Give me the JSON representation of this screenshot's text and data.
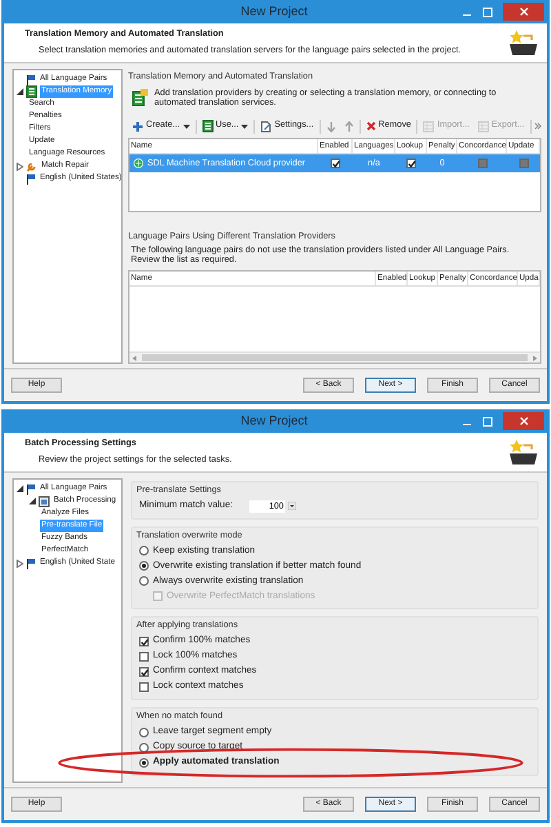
{
  "window_1": {
    "title": "New Project",
    "header": {
      "title": "Translation Memory and Automated Translation",
      "subtitle": "Select translation memories and automated translation servers for the language pairs selected in the project."
    },
    "tree": [
      {
        "label": "All Language Pairs",
        "selected": false
      },
      {
        "label": "Translation Memory",
        "expanded": true,
        "selected": true,
        "children": [
          {
            "label": "Search",
            "selected": false
          },
          {
            "label": "Penalties",
            "selected": false
          },
          {
            "label": "Filters",
            "selected": false
          },
          {
            "label": "Update",
            "selected": false
          },
          {
            "label": "Language Resources",
            "selected": false
          }
        ]
      },
      {
        "label": "Match Repair",
        "expanded": false,
        "selected": false
      },
      {
        "label": "English (United States)",
        "selected": false
      }
    ],
    "panel_title": "Translation Memory and Automated Translation",
    "info": "Add translation providers by creating or selecting a translation memory, or connecting to automated translation services.",
    "toolbar": [
      {
        "label": "Create...",
        "dropdown": true,
        "disabled": false
      },
      {
        "label": "Use...",
        "dropdown": true,
        "disabled": false
      },
      {
        "label": "Settings...",
        "dropdown": false,
        "disabled": false
      },
      {
        "dropdown": false,
        "disabled": true
      },
      {
        "dropdown": false,
        "disabled": true
      },
      {
        "label": "Remove",
        "dropdown": false,
        "disabled": false
      },
      {
        "label": "Import...",
        "dropdown": false,
        "disabled": true
      },
      {
        "label": "Export...",
        "dropdown": false,
        "disabled": true
      }
    ],
    "providers": {
      "columns": [
        "Name",
        "Enabled",
        "Languages",
        "Lookup",
        "Penalty",
        "Concordance",
        "Update"
      ],
      "rows": [
        {
          "selected": true,
          "cells": [
            {
              "kind": "name",
              "text": "SDL Machine Translation Cloud provider"
            },
            {
              "kind": "check",
              "checked": true,
              "disabled": false
            },
            {
              "kind": "text",
              "text": "n/a"
            },
            {
              "kind": "check",
              "checked": true,
              "disabled": false
            },
            {
              "kind": "text",
              "text": "0"
            },
            {
              "kind": "check",
              "checked": false,
              "disabled": true
            },
            {
              "kind": "check",
              "checked": false,
              "disabled": true
            }
          ]
        }
      ]
    },
    "other_title": "Language Pairs Using Different Translation Providers",
    "other_info": "The following language pairs do not use the translation providers listed under All Language Pairs. Review the list as required.",
    "other_table": {
      "columns": [
        "Name",
        "Enabled",
        "Lookup",
        "Penalty",
        "Concordance",
        "Upda"
      ]
    },
    "footer": {
      "left": [
        {
          "label": "Help",
          "default": false
        }
      ],
      "right": [
        {
          "label": "< Back",
          "default": false
        },
        {
          "label": "Next >",
          "default": true
        },
        {
          "label": "Finish",
          "default": false
        },
        {
          "label": "Cancel",
          "default": false
        }
      ]
    }
  },
  "window_2": {
    "title": "New Project",
    "header": {
      "title": "Batch Processing Settings",
      "subtitle": "Review the project settings for the selected tasks."
    },
    "tree": [
      {
        "label": "All Language Pairs",
        "expanded": true,
        "selected": false,
        "children": [
          {
            "label": "Batch Processing",
            "expanded": true,
            "selected": false,
            "children": [
              {
                "label": "Analyze Files",
                "selected": false
              },
              {
                "label": "Pre-translate File",
                "selected": true
              },
              {
                "label": "Fuzzy Bands",
                "selected": false
              },
              {
                "label": "PerfectMatch",
                "selected": false
              }
            ]
          }
        ]
      },
      {
        "label": "English (United State",
        "expanded": false,
        "selected": false
      }
    ],
    "groups": [
      {
        "title": "Pre-translate Settings",
        "items": [
          {
            "kind": "spin",
            "label": "Minimum match value:",
            "value": "100"
          }
        ]
      },
      {
        "title": "Translation overwrite mode",
        "items": [
          {
            "kind": "radio",
            "label": "Keep existing translation",
            "selected": false
          },
          {
            "kind": "radio",
            "label": "Overwrite existing translation if better match found",
            "selected": true
          },
          {
            "kind": "radio",
            "label": "Always overwrite existing translation",
            "selected": false,
            "children": [
              {
                "kind": "check",
                "label": "Overwrite PerfectMatch translations",
                "checked": false,
                "disabled": true
              }
            ]
          }
        ]
      },
      {
        "title": "After applying translations",
        "items": [
          {
            "kind": "check",
            "label": "Confirm 100% matches",
            "checked": true,
            "disabled": false
          },
          {
            "kind": "check",
            "label": "Lock 100% matches",
            "checked": false,
            "disabled": false
          },
          {
            "kind": "check",
            "label": "Confirm context matches",
            "checked": true,
            "disabled": false
          },
          {
            "kind": "check",
            "label": "Lock context matches",
            "checked": false,
            "disabled": false
          }
        ]
      },
      {
        "title": "When no match found",
        "items": [
          {
            "kind": "radio",
            "label": "Leave target segment empty",
            "selected": false
          },
          {
            "kind": "radio",
            "label": "Copy source to target",
            "selected": false
          },
          {
            "kind": "radio",
            "label": "Apply automated translation",
            "selected": true,
            "highlighted": true
          }
        ]
      }
    ],
    "footer": {
      "left": [
        {
          "label": "Help",
          "default": false
        }
      ],
      "right": [
        {
          "label": "< Back",
          "default": false
        },
        {
          "label": "Next >",
          "default": true
        },
        {
          "label": "Finish",
          "default": false
        },
        {
          "label": "Cancel",
          "default": false
        }
      ]
    }
  }
}
